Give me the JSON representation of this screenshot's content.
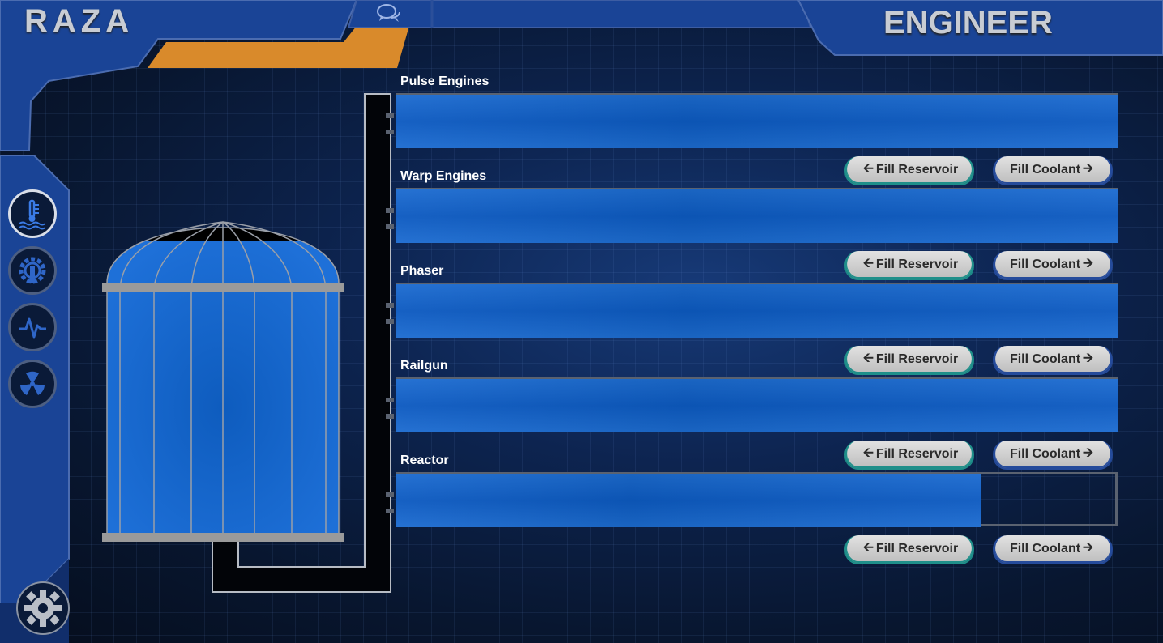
{
  "header": {
    "brand": "RAZA",
    "role": "ENGINEER"
  },
  "icons": {
    "chat": "chat-bubbles-icon",
    "nav": [
      "coolant-temperature-icon",
      "engine-gear-icon",
      "pulse-wave-icon",
      "radiation-icon"
    ],
    "settings": "settings-gear-icon"
  },
  "colors": {
    "frame_blue": "#1a4496",
    "accent_orange": "#d98a2b",
    "coolant_blue": "#1a6ad0",
    "reservoir_button_edge": "#1f8f8a",
    "coolant_button_edge": "#254b9b"
  },
  "reservoir": {
    "fill_fraction": 0.93
  },
  "systems": [
    {
      "name": "Pulse Engines",
      "fill_fraction": 1.0,
      "reservoir_label": "Fill Reservoir",
      "coolant_label": "Fill Coolant"
    },
    {
      "name": "Warp Engines",
      "fill_fraction": 1.0,
      "reservoir_label": "Fill Reservoir",
      "coolant_label": "Fill Coolant"
    },
    {
      "name": "Phaser",
      "fill_fraction": 1.0,
      "reservoir_label": "Fill Reservoir",
      "coolant_label": "Fill Coolant"
    },
    {
      "name": "Railgun",
      "fill_fraction": 1.0,
      "reservoir_label": "Fill Reservoir",
      "coolant_label": "Fill Coolant"
    },
    {
      "name": "Reactor",
      "fill_fraction": 0.81,
      "reservoir_label": "Fill Reservoir",
      "coolant_label": "Fill Coolant"
    }
  ]
}
